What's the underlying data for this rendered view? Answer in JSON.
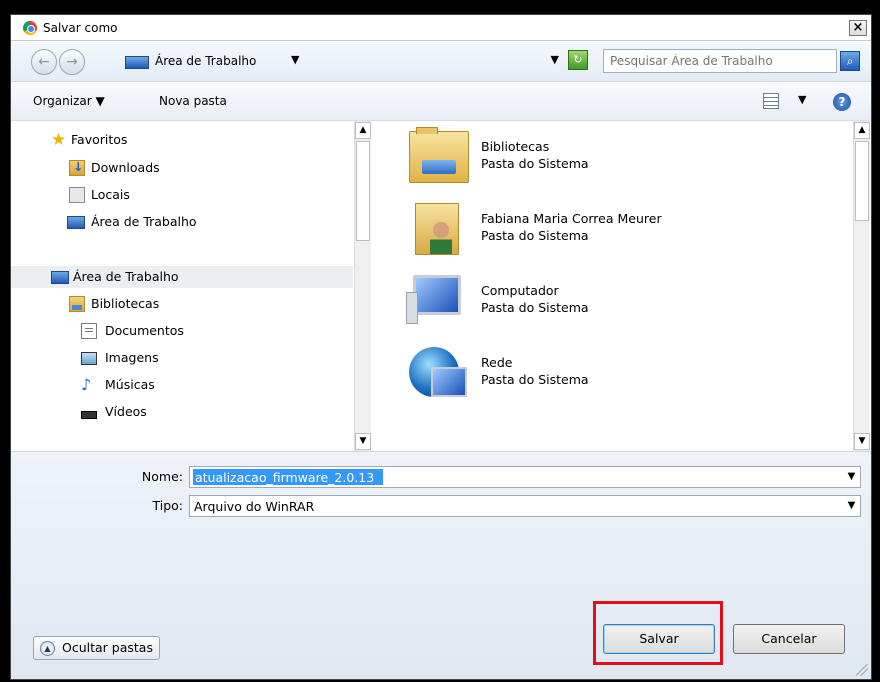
{
  "window": {
    "title": "Salvar como",
    "close": "×"
  },
  "nav": {
    "back": "←",
    "forward": "→",
    "address": "Área de Trabalho",
    "address_chevron": "▼",
    "address_dropdown": "▼",
    "refresh": "↻",
    "search_placeholder": "Pesquisar Área de Trabalho",
    "search_button": "⌕"
  },
  "toolbar": {
    "organize": "Organizar ▼",
    "new_folder": "Nova pasta",
    "view_dropdown": "▼",
    "help": "?"
  },
  "sidebar": {
    "items": [
      {
        "label": "Favoritos"
      },
      {
        "label": "Downloads"
      },
      {
        "label": "Locais"
      },
      {
        "label": "Área de Trabalho"
      },
      {
        "label": "Área de Trabalho"
      },
      {
        "label": "Bibliotecas"
      },
      {
        "label": "Documentos"
      },
      {
        "label": "Imagens"
      },
      {
        "label": "Músicas"
      },
      {
        "label": "Vídeos"
      }
    ]
  },
  "files": [
    {
      "name": "Bibliotecas",
      "type": "Pasta do Sistema"
    },
    {
      "name": "Fabiana Maria Correa Meurer",
      "type": "Pasta do Sistema"
    },
    {
      "name": "Computador",
      "type": "Pasta do Sistema"
    },
    {
      "name": "Rede",
      "type": "Pasta do Sistema"
    }
  ],
  "form": {
    "name_label": "Nome:",
    "name_value": "atualizacao_firmware_2.0.13",
    "type_label": "Tipo:",
    "type_value": "Arquivo do WinRAR",
    "dropdown": "▼"
  },
  "buttons": {
    "hide_folders": "Ocultar pastas",
    "hide_icon": "▲",
    "save": "Salvar",
    "cancel": "Cancelar"
  },
  "scroll": {
    "up": "▲",
    "down": "▼"
  },
  "colors": {
    "highlight": "#e0101a",
    "selection": "#3399ff"
  }
}
